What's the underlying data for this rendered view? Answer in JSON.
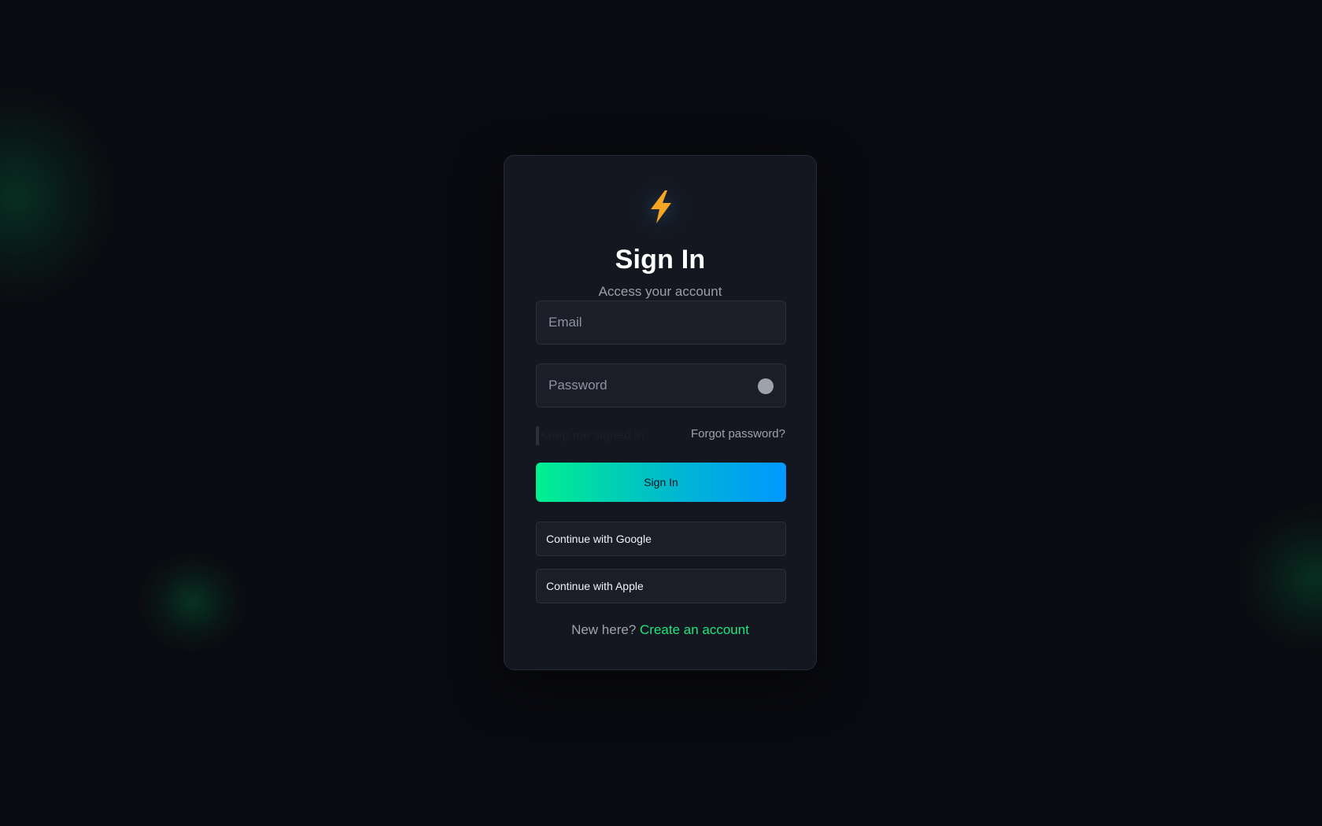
{
  "colors": {
    "background": "#0a0b10",
    "card": "#141720",
    "accent_green": "#1ee57f",
    "gradient_start": "#00f090",
    "gradient_end": "#0098ff",
    "logo_bolt": "#f5a623"
  },
  "logo": {
    "icon": "lightning-bolt-icon"
  },
  "header": {
    "title": "Sign In",
    "subtitle": "Access your account"
  },
  "form": {
    "email": {
      "placeholder": "Email",
      "value": ""
    },
    "password": {
      "placeholder": "Password",
      "value": "",
      "toggle_icon": "eye-toggle-icon"
    },
    "remember_label": "Keep me signed in",
    "remember_checked": false,
    "forgot_label": "Forgot password?",
    "submit_label": "Sign In"
  },
  "social": {
    "google_label": "Continue with Google",
    "apple_label": "Continue with Apple"
  },
  "footer": {
    "prompt": "New here?",
    "link_label": "Create an account"
  }
}
